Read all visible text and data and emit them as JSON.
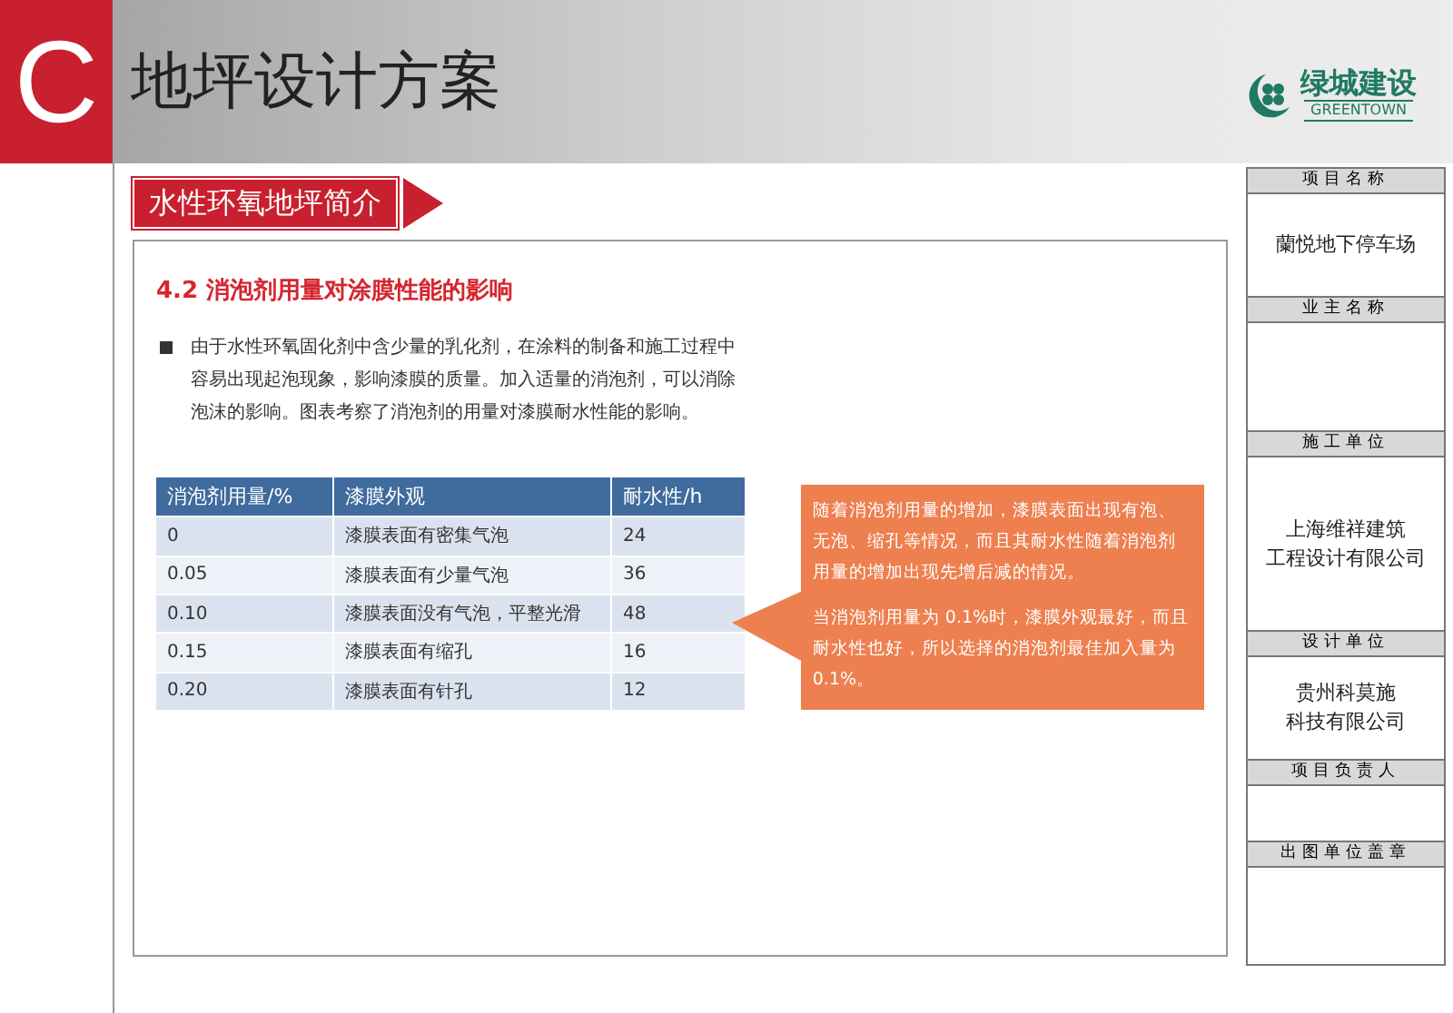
{
  "header": {
    "letter": "C",
    "title": "地坪设计方案",
    "logo": {
      "name": "绿城建设",
      "subtitle": "GREENTOWN"
    }
  },
  "section_tag": "水性环氧地坪简介",
  "content": {
    "heading": "4.2 消泡剂用量对涂膜性能的影响",
    "bullet": "由于水性环氧固化剂中含少量的乳化剂，在涂料的制备和施工过程中容易出现起泡现象，影响漆膜的质量。加入适量的消泡剂，可以消除泡沫的影响。图表考察了消泡剂的用量对漆膜耐水性能的影响。",
    "table": {
      "columns": [
        "消泡剂用量/%",
        "漆膜外观",
        "耐水性/h"
      ],
      "rows": [
        [
          "0",
          "漆膜表面有密集气泡",
          "24"
        ],
        [
          "0.05",
          "漆膜表面有少量气泡",
          "36"
        ],
        [
          "0.10",
          "漆膜表面没有气泡，平整光滑",
          "48"
        ],
        [
          "0.15",
          "漆膜表面有缩孔",
          "16"
        ],
        [
          "0.20",
          "漆膜表面有针孔",
          "12"
        ]
      ]
    },
    "callout": [
      "随着消泡剂用量的增加，漆膜表面出现有泡、无泡、缩孔等情况，而且其耐水性随着消泡剂用量的增加出现先增后减的情况。",
      "当消泡剂用量为 0.1%时，漆膜外观最好，而且耐水性也好，所以选择的消泡剂最佳加入量为0.1%。"
    ]
  },
  "title_block": [
    {
      "label": "项目名称",
      "value": [
        "蘭悦地下停车场"
      ]
    },
    {
      "label": "业主名称"
    },
    {
      "label": "施工单位",
      "value": [
        "上海维祥建筑",
        "工程设计有限公司"
      ]
    },
    {
      "label": "设计单位",
      "value": [
        "贵州科莫施",
        "科技有限公司"
      ]
    },
    {
      "label": "项目负责人"
    },
    {
      "label": "出图单位盖章"
    }
  ]
}
